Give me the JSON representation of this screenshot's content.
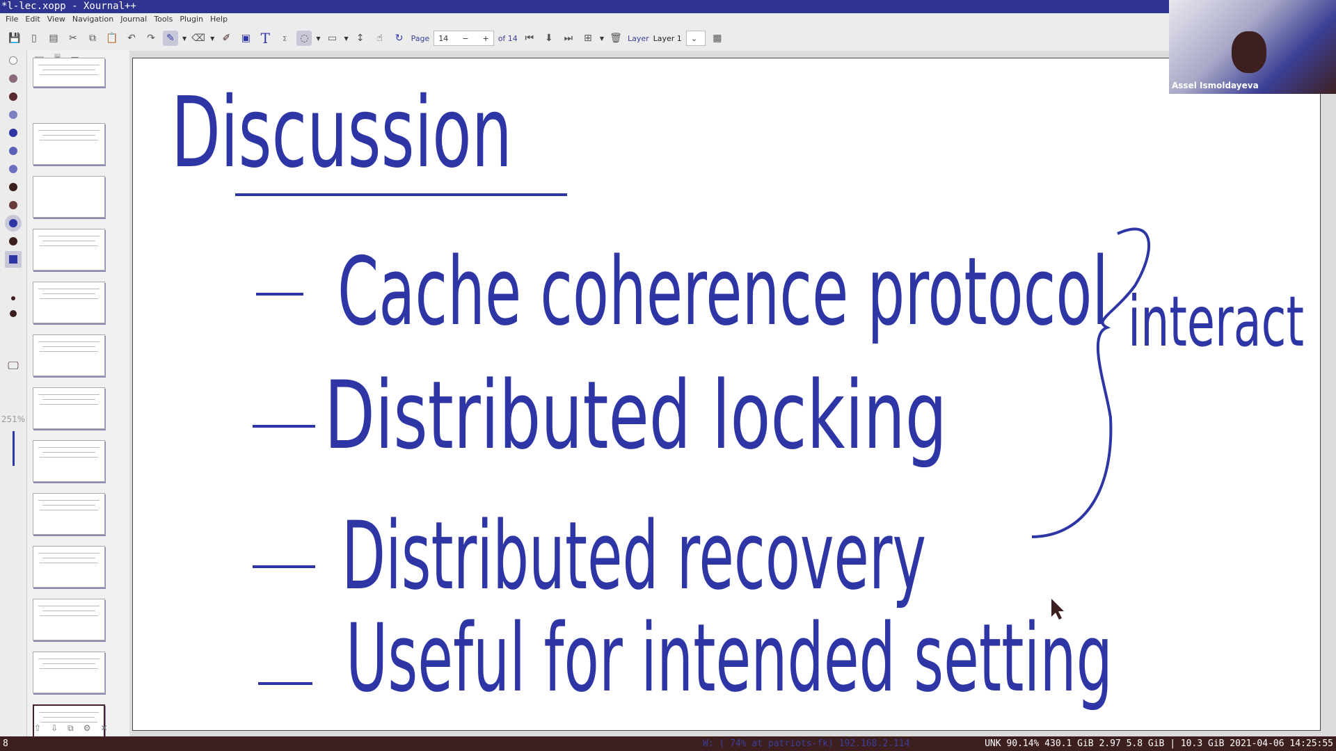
{
  "window": {
    "title": "*l-lec.xopp - Xournal++"
  },
  "menu": [
    "File",
    "Edit",
    "View",
    "Navigation",
    "Journal",
    "Tools",
    "Plugin",
    "Help"
  ],
  "toolbar": {
    "page_label": "Page",
    "page_value": "14",
    "page_total": "of 14",
    "layer_label": "Layer",
    "layer_value": "Layer 1"
  },
  "sidebar": {
    "zoom": "251%",
    "thumbnail_count": 13,
    "selected_page": 14
  },
  "page": {
    "title": "Discussion",
    "items": [
      "Cache coherence protocol",
      "Distributed locking",
      "Distributed recovery",
      "Useful for intended setting"
    ],
    "annotation": "interact",
    "ink_color": "#2e36a6"
  },
  "webcam": {
    "name": "Assel Ismoldayeva"
  },
  "status": {
    "left": "8",
    "network": "W: ( 74% at patriots-fk) 192.168.2.114",
    "right": "UNK 90.14% 430.1 GiB 2.97 5.8 GiB | 10.3 GiB 2021-04-06 14:25:55"
  }
}
